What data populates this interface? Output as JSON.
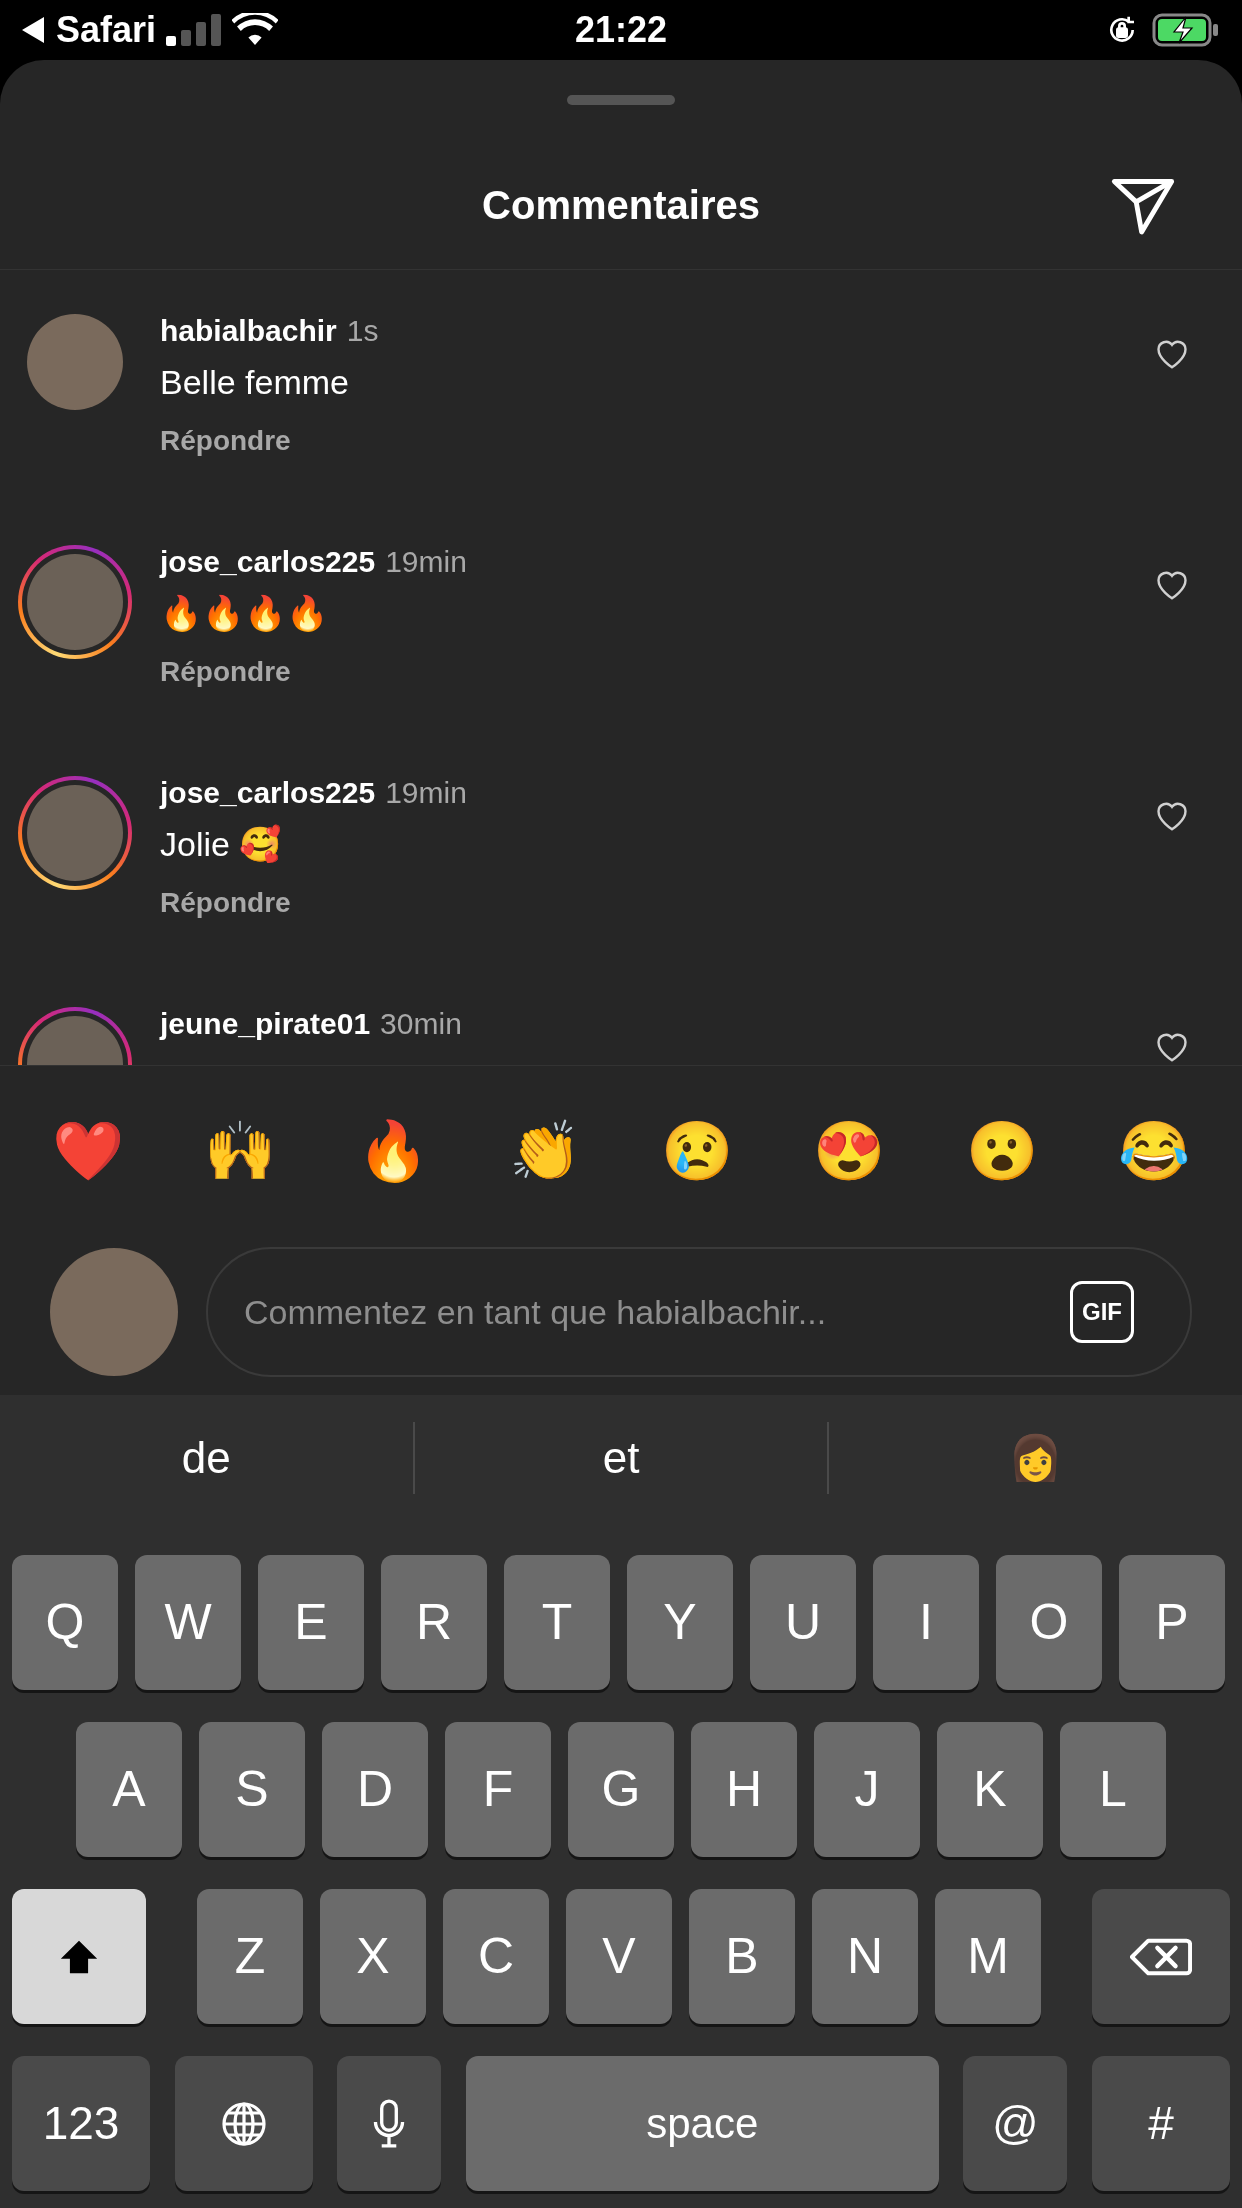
{
  "status_bar": {
    "back_label": "Safari",
    "time": "21:22"
  },
  "title": "Commentaires",
  "comments": [
    {
      "username": "habialbachir",
      "time": "1s",
      "text": "Belle femme",
      "reply": "Répondre",
      "story_ring": false,
      "liked": false
    },
    {
      "username": "jose_carlos225",
      "time": "19min",
      "text": "🔥🔥🔥🔥",
      "reply": "Répondre",
      "story_ring": true,
      "liked": false
    },
    {
      "username": "jose_carlos225",
      "time": "19min",
      "text": "Jolie 🥰",
      "reply": "Répondre",
      "story_ring": true,
      "liked": false
    },
    {
      "username": "jeune_pirate01",
      "time": "30min",
      "story_ring": true,
      "liked": false
    }
  ],
  "reactions": [
    "❤️",
    "🙌",
    "🔥",
    "👏",
    "😢",
    "😍",
    "😮",
    "😂"
  ],
  "comment_field": {
    "placeholder": "Commentez en tant que habialbachir...",
    "gif_label": "GIF"
  },
  "keyboard": {
    "suggestions": [
      "de",
      "et",
      "👩"
    ],
    "rows": [
      [
        {
          "kind": "letter",
          "label": "Q"
        },
        {
          "kind": "letter",
          "label": "W"
        },
        {
          "kind": "letter",
          "label": "E"
        },
        {
          "kind": "letter",
          "label": "R"
        },
        {
          "kind": "letter",
          "label": "T"
        },
        {
          "kind": "letter",
          "label": "Y"
        },
        {
          "kind": "letter",
          "label": "U"
        },
        {
          "kind": "letter",
          "label": "I"
        },
        {
          "kind": "letter",
          "label": "O"
        },
        {
          "kind": "letter",
          "label": "P"
        }
      ],
      [
        {
          "kind": "letter",
          "label": "A"
        },
        {
          "kind": "letter",
          "label": "S"
        },
        {
          "kind": "letter",
          "label": "D"
        },
        {
          "kind": "letter",
          "label": "F"
        },
        {
          "kind": "letter",
          "label": "G"
        },
        {
          "kind": "letter",
          "label": "H"
        },
        {
          "kind": "letter",
          "label": "J"
        },
        {
          "kind": "letter",
          "label": "K"
        },
        {
          "kind": "letter",
          "label": "L"
        }
      ],
      [
        {
          "kind": "shift",
          "selected": true
        },
        {
          "kind": "letter",
          "label": "Z"
        },
        {
          "kind": "letter",
          "label": "X"
        },
        {
          "kind": "letter",
          "label": "C"
        },
        {
          "kind": "letter",
          "label": "V"
        },
        {
          "kind": "letter",
          "label": "B"
        },
        {
          "kind": "letter",
          "label": "N"
        },
        {
          "kind": "letter",
          "label": "M"
        },
        {
          "kind": "backspace"
        }
      ]
    ],
    "bottom_keys": [
      {
        "kind": "wide",
        "label": "123"
      },
      {
        "kind": "globe"
      },
      {
        "kind": "mic"
      },
      {
        "kind": "space",
        "label": "space"
      },
      {
        "kind": "narrow",
        "label": "@"
      },
      {
        "kind": "wide",
        "label": "#"
      }
    ]
  }
}
